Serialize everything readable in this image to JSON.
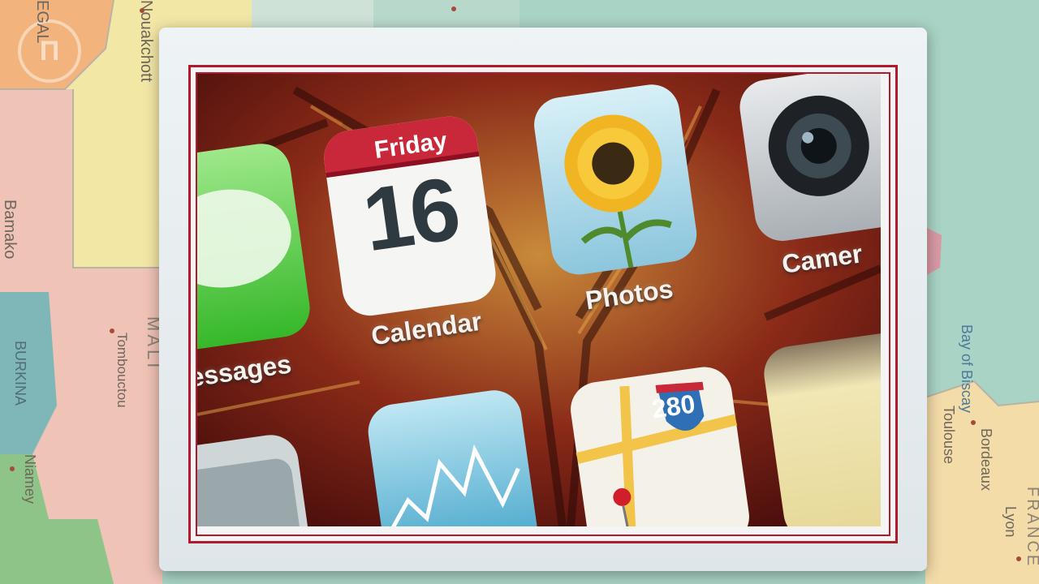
{
  "map": {
    "labels": {
      "senegal": "EGAL",
      "nouakchott": "Nouakchott",
      "bamako": "Bamako",
      "tombouctou": "Tombouctou",
      "mali": "MALI",
      "burkina": "BURKINA",
      "niamey": "Niamey",
      "bay_of_biscay": "Bay of Biscay",
      "toulouse": "Toulouse",
      "bordeaux": "Bordeaux",
      "lyon": "Lyon",
      "france": "FRANCE"
    }
  },
  "phone_screen": {
    "messages_label": "essages",
    "calendar_day": "Friday",
    "calendar_date": "16",
    "calendar_label": "Calendar",
    "photos_label": "Photos",
    "camera_label": "Camer",
    "maps_shield_number": "280"
  },
  "colors": {
    "frame_red": "#b11a2a",
    "card_white": "#eef3f5",
    "screen_background": "#5a1410"
  }
}
